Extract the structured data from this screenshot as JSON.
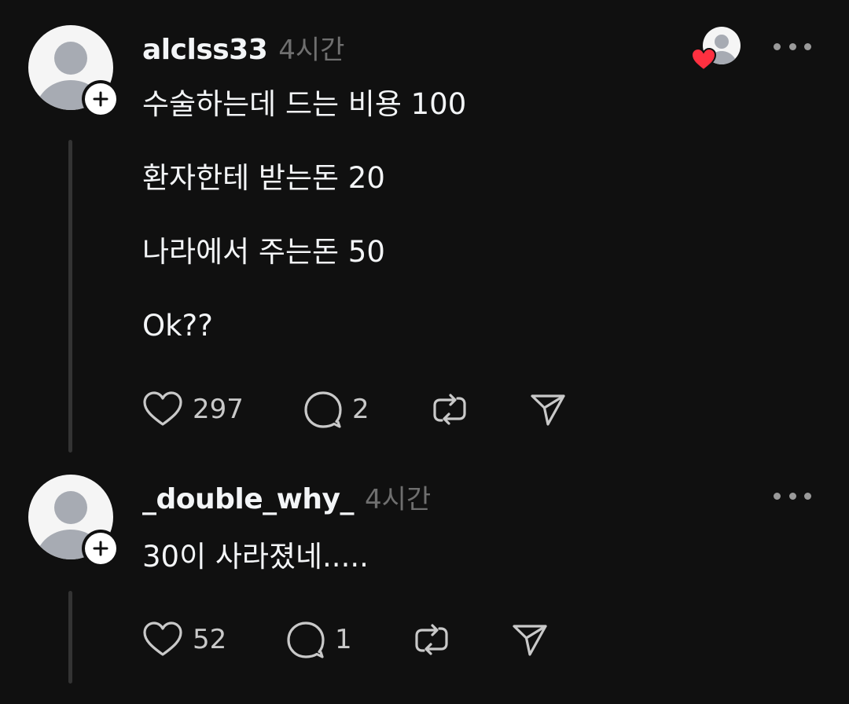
{
  "posts": [
    {
      "author": "alclss33",
      "time": "4시간",
      "lines": [
        "수술하는데 드는 비용 100",
        "환자한테 받는돈 20",
        "나라에서 주는돈 50",
        "Ok??"
      ],
      "likes": "297",
      "replies": "2",
      "liked_by_indicator": "heart-icon"
    },
    {
      "author": "_double_why_",
      "time": "4시간",
      "lines": [
        "30이 사라졌네....."
      ],
      "likes": "52",
      "replies": "1"
    }
  ],
  "colors": {
    "background": "#101010",
    "text": "#f3f5f7",
    "muted": "#6f6f6f",
    "icon": "#c9c9c9",
    "heart": "#ff3040",
    "thread_line": "#333333"
  }
}
